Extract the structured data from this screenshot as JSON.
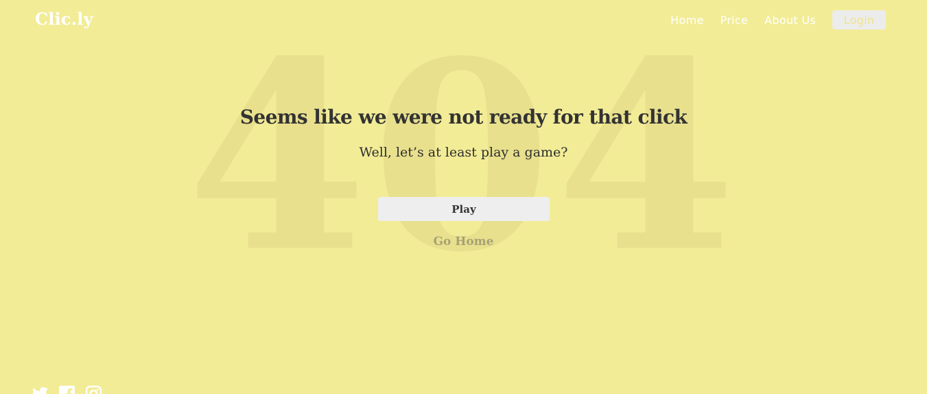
{
  "brand": {
    "logo_text": "Clic.ly"
  },
  "nav": {
    "items": [
      {
        "label": "Home"
      },
      {
        "label": "Price"
      },
      {
        "label": "About Us"
      }
    ],
    "login_label": "Login"
  },
  "error": {
    "background_code": "404",
    "headline": "Seems like we were not ready for that click",
    "subline": "Well, let’s at least play a game?",
    "play_label": "Play",
    "go_home_label": "Go Home"
  },
  "social": {
    "icons": [
      "twitter-icon",
      "facebook-icon",
      "instagram-icon"
    ]
  },
  "colors": {
    "background": "#f2ec97",
    "watermark": "#e8e08d",
    "text_dark": "#333333",
    "link_muted": "#a6a274",
    "button_bg": "#eeeeee",
    "login_text": "#efe48a"
  }
}
